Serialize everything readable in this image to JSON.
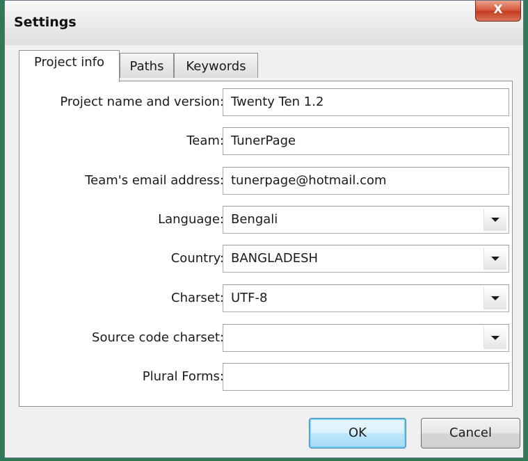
{
  "window": {
    "title": "Settings",
    "close_label": "X"
  },
  "tabs": [
    {
      "label": "Project info",
      "active": true
    },
    {
      "label": "Paths",
      "active": false
    },
    {
      "label": "Keywords",
      "active": false
    }
  ],
  "form": {
    "project_name": {
      "label": "Project name and version:",
      "value": "Twenty Ten 1.2"
    },
    "team": {
      "label": "Team:",
      "value": "TunerPage"
    },
    "team_email": {
      "label": "Team's email address:",
      "value": "tunerpage@hotmail.com"
    },
    "language": {
      "label": "Language:",
      "value": "Bengali"
    },
    "country": {
      "label": "Country:",
      "value": "BANGLADESH"
    },
    "charset": {
      "label": "Charset:",
      "value": "UTF-8"
    },
    "source_charset": {
      "label": "Source code charset:",
      "value": ""
    },
    "plural_forms": {
      "label": "Plural Forms:",
      "value": ""
    }
  },
  "buttons": {
    "ok_label": "OK",
    "cancel_label": "Cancel"
  },
  "colors": {
    "desktop_background": "#2e7a56",
    "close_button": "#c43b1e",
    "default_button_border": "#3c7fb1"
  },
  "icons": {
    "close": "close-icon",
    "dropdown": "chevron-down-icon"
  }
}
